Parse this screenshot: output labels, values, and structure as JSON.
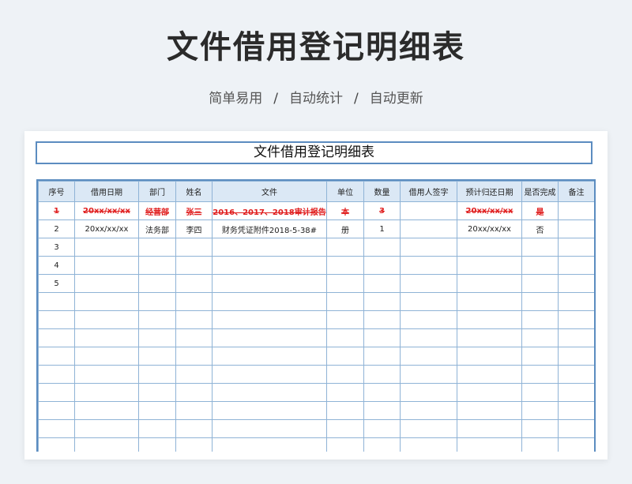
{
  "hero": {
    "title": "文件借用登记明细表",
    "tags": [
      "简单易用",
      "自动统计",
      "自动更新"
    ],
    "separator": "/"
  },
  "sheet": {
    "title": "文件借用登记明细表",
    "columns": [
      "序号",
      "借用日期",
      "部门",
      "姓名",
      "文件",
      "单位",
      "数量",
      "借用人签字",
      "预计归还日期",
      "是否完成",
      "备注"
    ],
    "rows": [
      {
        "seq": "1",
        "date": "20xx/xx/xx",
        "dept": "经营部",
        "name": "张三",
        "file": "2016、2017、2018审计报告",
        "unit": "本",
        "qty": "3",
        "sign": "",
        "return_date": "20xx/xx/xx",
        "done": "是",
        "note": "",
        "struck": true
      },
      {
        "seq": "2",
        "date": "20xx/xx/xx",
        "dept": "法务部",
        "name": "李四",
        "file": "财务凭证附件2018-5-38#",
        "unit": "册",
        "qty": "1",
        "sign": "",
        "return_date": "20xx/xx/xx",
        "done": "否",
        "note": "",
        "struck": false
      },
      {
        "seq": "3",
        "date": "",
        "dept": "",
        "name": "",
        "file": "",
        "unit": "",
        "qty": "",
        "sign": "",
        "return_date": "",
        "done": "",
        "note": "",
        "struck": false
      },
      {
        "seq": "4",
        "date": "",
        "dept": "",
        "name": "",
        "file": "",
        "unit": "",
        "qty": "",
        "sign": "",
        "return_date": "",
        "done": "",
        "note": "",
        "struck": false
      },
      {
        "seq": "5",
        "date": "",
        "dept": "",
        "name": "",
        "file": "",
        "unit": "",
        "qty": "",
        "sign": "",
        "return_date": "",
        "done": "",
        "note": "",
        "struck": false
      }
    ],
    "empty_rows": 9,
    "colors": {
      "border": "#5b8cc0",
      "grid": "#8fb3d6",
      "header_bg": "#dbe8f5",
      "struck_text": "#e02020"
    }
  }
}
